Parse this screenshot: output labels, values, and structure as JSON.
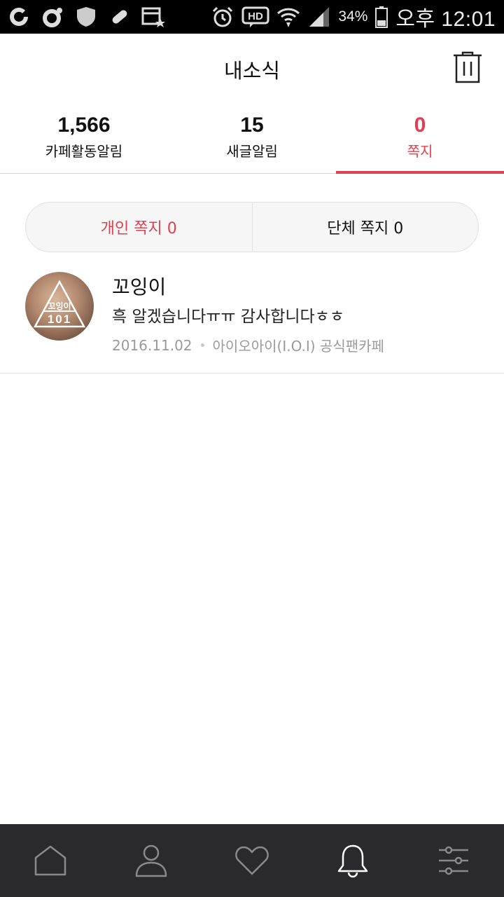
{
  "status_bar": {
    "battery": "34%",
    "time": "오후 12:01",
    "icons": [
      "g-icon",
      "o-icon",
      "shield-icon",
      "pill-icon",
      "calendar-icon",
      "alarm-icon",
      "hd-icon",
      "wifi-icon",
      "signal-icon",
      "battery-icon"
    ]
  },
  "header": {
    "title": "내소식",
    "trash_icon": "trash-icon"
  },
  "tabs": [
    {
      "count": "1,566",
      "label": "카페활동알림",
      "active": false
    },
    {
      "count": "15",
      "label": "새글알림",
      "active": false
    },
    {
      "count": "0",
      "label": "쪽지",
      "active": true
    }
  ],
  "segment": {
    "personal": "개인 쪽지 0",
    "group": "단체 쪽지 0"
  },
  "messages": [
    {
      "sender": "꼬잉이",
      "preview": "흑 알겠습니다ㅠㅠ 감사합니다ㅎㅎ",
      "date": "2016.11.02",
      "cafe": "아이오아이(I.O.I) 공식팬카페",
      "avatar_text": "꼬잉이",
      "avatar_num": "101"
    }
  ],
  "bottom_nav": [
    "home-icon",
    "profile-icon",
    "favorites-icon",
    "notifications-icon",
    "settings-icon"
  ],
  "colors": {
    "accent": "#e04050",
    "nav_bg": "#2a2a2e"
  }
}
